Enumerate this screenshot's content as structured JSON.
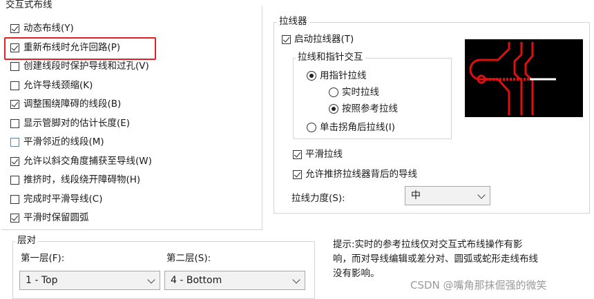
{
  "interactive_routing": {
    "title": "交互式布线",
    "options": [
      {
        "label": "动态布线(Y)",
        "checked": true
      },
      {
        "label": "重新布线时允许回路(P)",
        "checked": true
      },
      {
        "label": "创建线段时保护导线和过孔(V)",
        "checked": false
      },
      {
        "label": "允许导线颈缩(K)",
        "checked": false
      },
      {
        "label": "调整围绕障碍的线段(B)",
        "checked": true
      },
      {
        "label": "显示管脚对的估计长度(E)",
        "checked": false
      },
      {
        "label": "平滑邻近的线段(M)",
        "checked": false
      },
      {
        "label": "允许以斜交角度捕获至导线(W)",
        "checked": true
      },
      {
        "label": "推挤时，线段绕开障碍物(H)",
        "checked": false
      },
      {
        "label": "完成时平滑导线(C)",
        "checked": false
      },
      {
        "label": "平滑时保留圆弧",
        "checked": true
      }
    ]
  },
  "layer_pair": {
    "title": "层对",
    "first_label": "第一层(F):",
    "first_value": "1 - Top",
    "second_label": "第二层(S):",
    "second_value": "4 - Bottom"
  },
  "tugger": {
    "title": "拉线器",
    "enable_label": "启动拉线器(T)",
    "enable_checked": true,
    "pointer_group_title": "拉线和指针交互",
    "use_pointer_label": "用指针拉线",
    "realtime_label": "实时拉线",
    "ref_label": "按照参考拉线",
    "single_click_label": "单击拐角后拉线(I)",
    "smooth_label": "平滑拉线",
    "smooth_checked": true,
    "allow_push_label": "允许推挤拉线器背后的导线",
    "allow_push_checked": true,
    "strength_label": "拉线力度(S):",
    "strength_value": "中"
  },
  "hint": {
    "line1": "提示:实时的参考拉线仅对交互式布线操作有影",
    "line2": "响，而对导线编辑或差分对、圆弧或蛇形走线布线",
    "line3": "没有影响。"
  },
  "watermark": "CSDN @嘴角那抹倔强的微笑",
  "colors": {
    "highlight": "#e02020",
    "preview_bg": "#000000",
    "trace": "#e01010"
  }
}
